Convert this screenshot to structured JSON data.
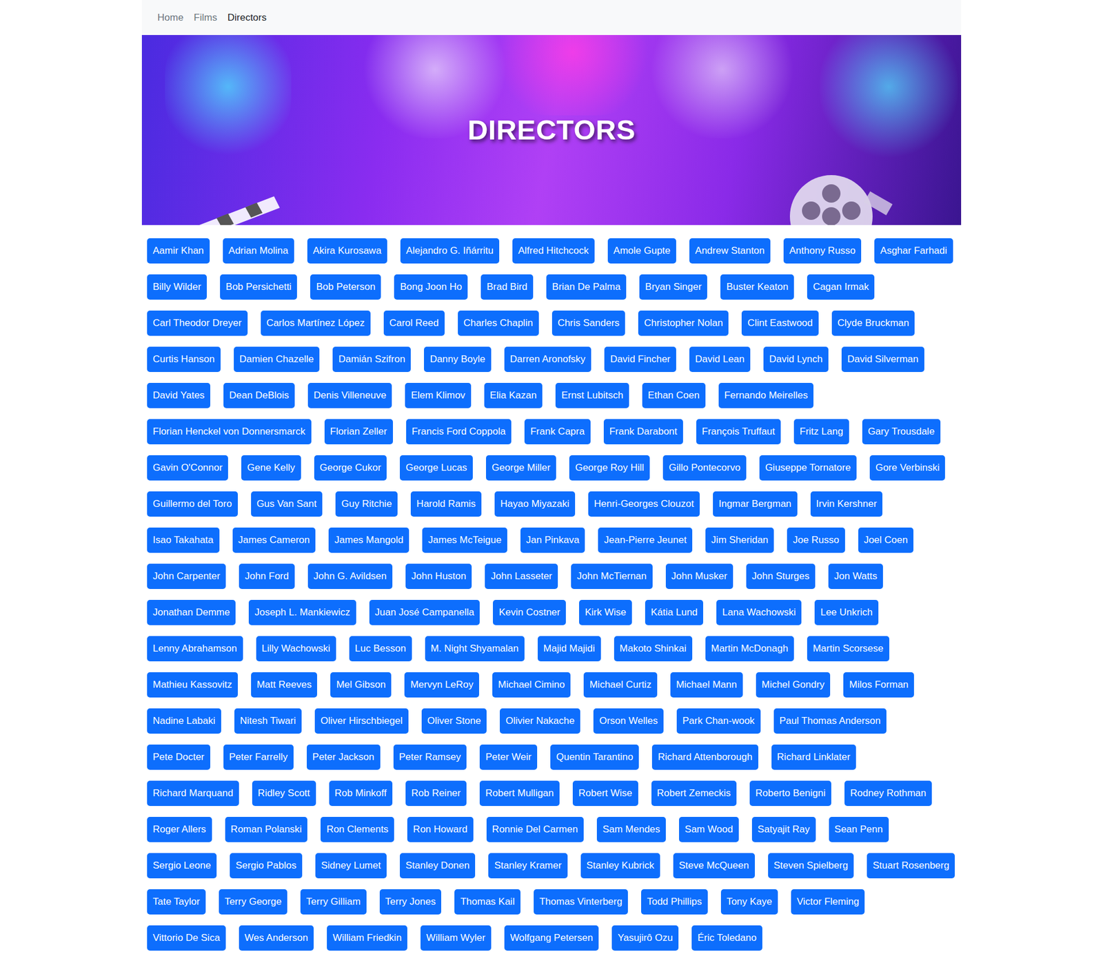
{
  "nav": {
    "items": [
      {
        "label": "Home",
        "selected": false
      },
      {
        "label": "Films",
        "selected": false
      },
      {
        "label": "Directors",
        "selected": true
      }
    ]
  },
  "banner": {
    "title": "DIRECTORS"
  },
  "directors": [
    "Aamir Khan",
    "Adrian Molina",
    "Akira Kurosawa",
    "Alejandro G. Iñárritu",
    "Alfred Hitchcock",
    "Amole Gupte",
    "Andrew Stanton",
    "Anthony Russo",
    "Asghar Farhadi",
    "Billy Wilder",
    "Bob Persichetti",
    "Bob Peterson",
    "Bong Joon Ho",
    "Brad Bird",
    "Brian De Palma",
    "Bryan Singer",
    "Buster Keaton",
    "Cagan Irmak",
    "Carl Theodor Dreyer",
    "Carlos Martínez López",
    "Carol Reed",
    "Charles Chaplin",
    "Chris Sanders",
    "Christopher Nolan",
    "Clint Eastwood",
    "Clyde Bruckman",
    "Curtis Hanson",
    "Damien Chazelle",
    "Damián Szifron",
    "Danny Boyle",
    "Darren Aronofsky",
    "David Fincher",
    "David Lean",
    "David Lynch",
    "David Silverman",
    "David Yates",
    "Dean DeBlois",
    "Denis Villeneuve",
    "Elem Klimov",
    "Elia Kazan",
    "Ernst Lubitsch",
    "Ethan Coen",
    "Fernando Meirelles",
    "Florian Henckel von Donnersmarck",
    "Florian Zeller",
    "Francis Ford Coppola",
    "Frank Capra",
    "Frank Darabont",
    "François Truffaut",
    "Fritz Lang",
    "Gary Trousdale",
    "Gavin O'Connor",
    "Gene Kelly",
    "George Cukor",
    "George Lucas",
    "George Miller",
    "George Roy Hill",
    "Gillo Pontecorvo",
    "Giuseppe Tornatore",
    "Gore Verbinski",
    "Guillermo del Toro",
    "Gus Van Sant",
    "Guy Ritchie",
    "Harold Ramis",
    "Hayao Miyazaki",
    "Henri-Georges Clouzot",
    "Ingmar Bergman",
    "Irvin Kershner",
    "Isao Takahata",
    "James Cameron",
    "James Mangold",
    "James McTeigue",
    "Jan Pinkava",
    "Jean-Pierre Jeunet",
    "Jim Sheridan",
    "Joe Russo",
    "Joel Coen",
    "John Carpenter",
    "John Ford",
    "John G. Avildsen",
    "John Huston",
    "John Lasseter",
    "John McTiernan",
    "John Musker",
    "John Sturges",
    "Jon Watts",
    "Jonathan Demme",
    "Joseph L. Mankiewicz",
    "Juan José Campanella",
    "Kevin Costner",
    "Kirk Wise",
    "Kátia Lund",
    "Lana Wachowski",
    "Lee Unkrich",
    "Lenny Abrahamson",
    "Lilly Wachowski",
    "Luc Besson",
    "M. Night Shyamalan",
    "Majid Majidi",
    "Makoto Shinkai",
    "Martin McDonagh",
    "Martin Scorsese",
    "Mathieu Kassovitz",
    "Matt Reeves",
    "Mel Gibson",
    "Mervyn LeRoy",
    "Michael Cimino",
    "Michael Curtiz",
    "Michael Mann",
    "Michel Gondry",
    "Milos Forman",
    "Nadine Labaki",
    "Nitesh Tiwari",
    "Oliver Hirschbiegel",
    "Oliver Stone",
    "Olivier Nakache",
    "Orson Welles",
    "Park Chan-wook",
    "Paul Thomas Anderson",
    "Pete Docter",
    "Peter Farrelly",
    "Peter Jackson",
    "Peter Ramsey",
    "Peter Weir",
    "Quentin Tarantino",
    "Richard Attenborough",
    "Richard Linklater",
    "Richard Marquand",
    "Ridley Scott",
    "Rob Minkoff",
    "Rob Reiner",
    "Robert Mulligan",
    "Robert Wise",
    "Robert Zemeckis",
    "Roberto Benigni",
    "Rodney Rothman",
    "Roger Allers",
    "Roman Polanski",
    "Ron Clements",
    "Ron Howard",
    "Ronnie Del Carmen",
    "Sam Mendes",
    "Sam Wood",
    "Satyajit Ray",
    "Sean Penn",
    "Sergio Leone",
    "Sergio Pablos",
    "Sidney Lumet",
    "Stanley Donen",
    "Stanley Kramer",
    "Stanley Kubrick",
    "Steve McQueen",
    "Steven Spielberg",
    "Stuart Rosenberg",
    "Tate Taylor",
    "Terry George",
    "Terry Gilliam",
    "Terry Jones",
    "Thomas Kail",
    "Thomas Vinterberg",
    "Todd Phillips",
    "Tony Kaye",
    "Victor Fleming",
    "Vittorio De Sica",
    "Wes Anderson",
    "William Friedkin",
    "William Wyler",
    "Wolfgang Petersen",
    "Yasujirô Ozu",
    "Éric Toledano"
  ]
}
